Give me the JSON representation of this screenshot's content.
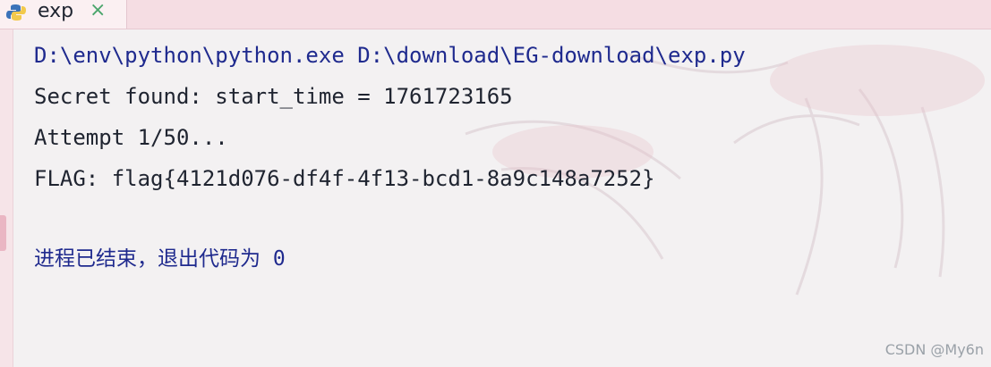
{
  "tab": {
    "title": "exp",
    "close": "×",
    "icon": "python-file-icon"
  },
  "console": {
    "lines": [
      "D:\\env\\python\\python.exe D:\\download\\EG-download\\exp.py",
      "Secret found: start_time = 1761723165",
      "Attempt 1/50...",
      "FLAG: flag{4121d076-df4f-4f13-bcd1-8a9c148a7252}",
      "",
      "进程已结束，退出代码为 0"
    ]
  },
  "watermark": "CSDN @My6n",
  "colors": {
    "command_text": "#1f2a8e",
    "output_text": "#1f2430",
    "close_icon": "#4aa56b",
    "tab_bar": "#f6d6de"
  }
}
